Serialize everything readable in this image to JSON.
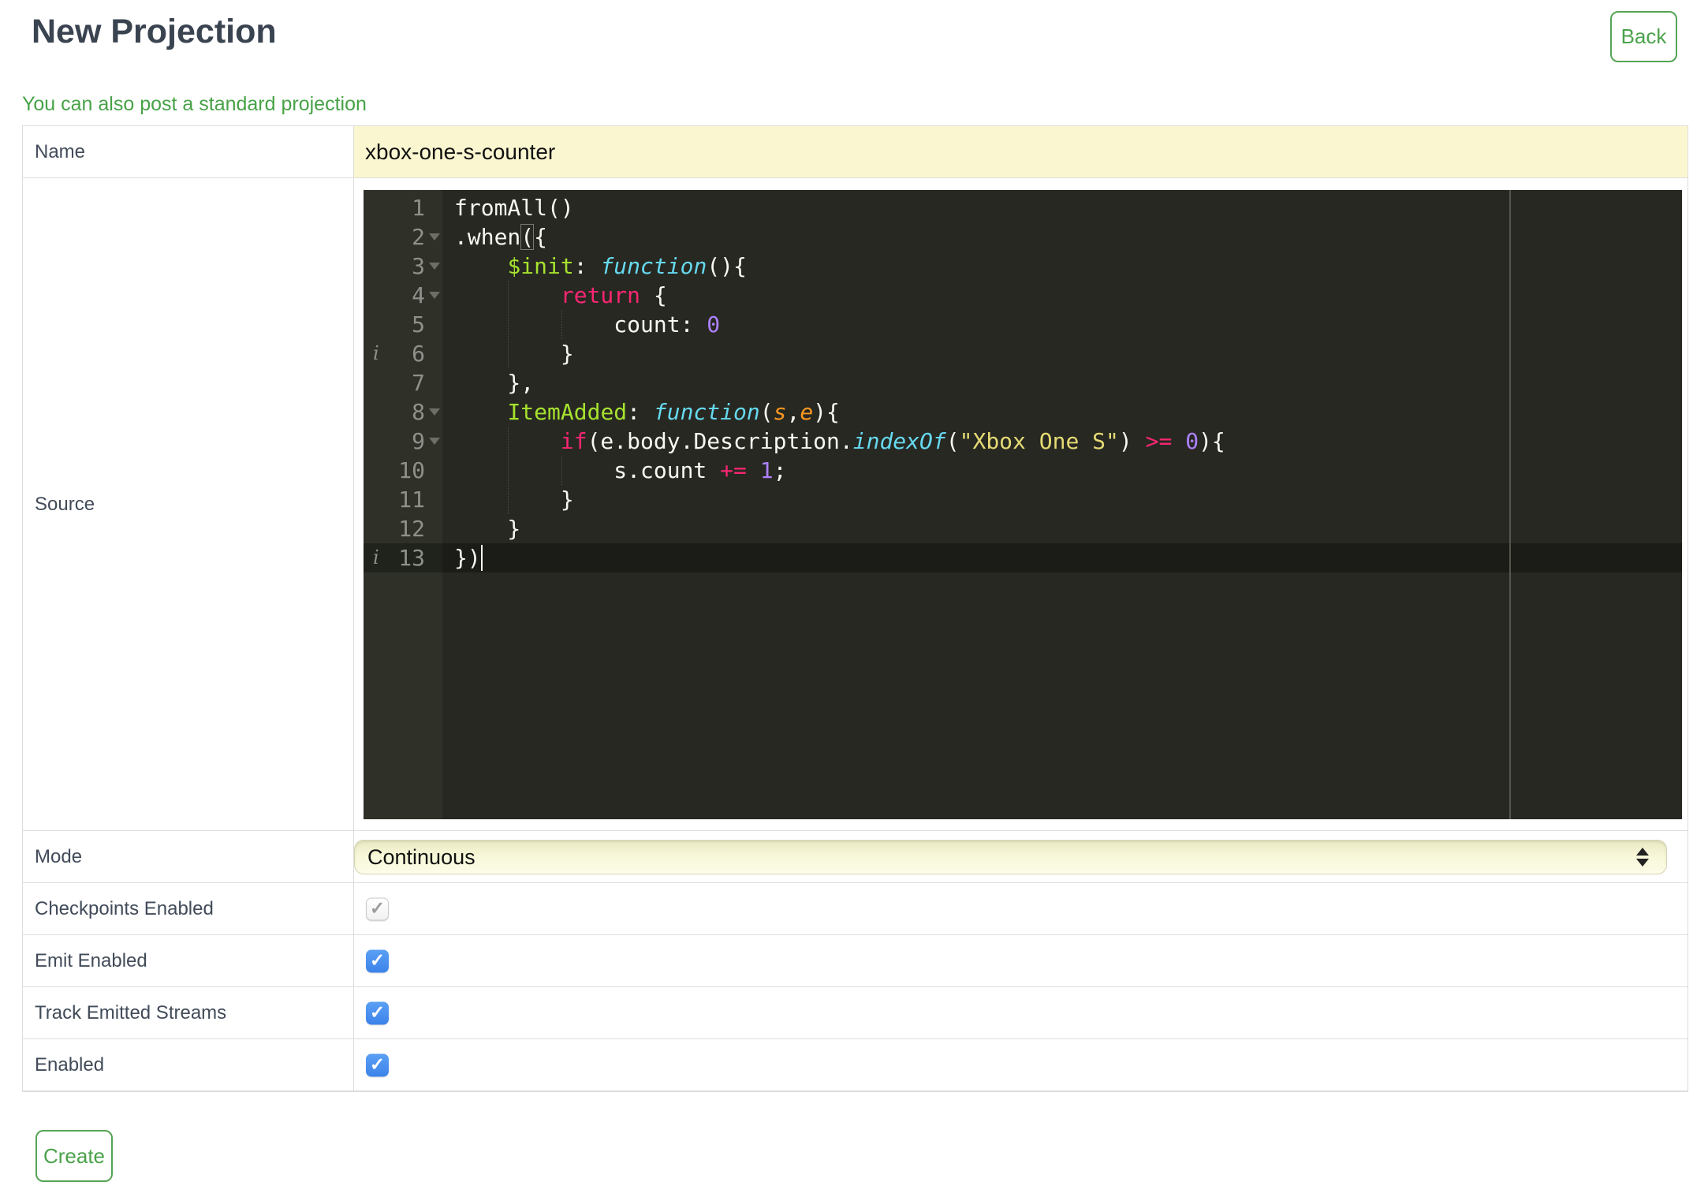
{
  "page": {
    "title": "New Projection"
  },
  "toolbar": {
    "back_label": "Back"
  },
  "links": {
    "standard_projection": "You can also post a standard projection"
  },
  "form": {
    "rows": [
      {
        "label": "Name",
        "type": "text",
        "value": "xbox-one-s-counter"
      },
      {
        "label": "Source",
        "type": "editor"
      },
      {
        "label": "Mode",
        "type": "select",
        "value": "Continuous"
      },
      {
        "label": "Checkpoints Enabled",
        "type": "checkbox",
        "checked": true,
        "disabled": true
      },
      {
        "label": "Emit Enabled",
        "type": "checkbox",
        "checked": true,
        "disabled": false
      },
      {
        "label": "Track Emitted Streams",
        "type": "checkbox",
        "checked": true,
        "disabled": false
      },
      {
        "label": "Enabled",
        "type": "checkbox",
        "checked": true,
        "disabled": false
      }
    ],
    "create_label": "Create"
  },
  "colors": {
    "accent_green": "#4ba24b",
    "input_yellow": "#faf7d0",
    "checkbox_blue": "#3c83ea",
    "editor_background": "#272822",
    "keyword": "#f92672",
    "entity": "#a6e22e",
    "function": "#66d9ef",
    "string": "#e6db74",
    "number": "#ae81ff",
    "param": "#fd971f"
  },
  "editor": {
    "language": "javascript",
    "lines": [
      {
        "number": 1,
        "tokens": [
          [
            "w",
            "fromAll()"
          ]
        ]
      },
      {
        "number": 2,
        "fold": true,
        "tokens": [
          [
            "w",
            ".when"
          ],
          [
            "m",
            "("
          ],
          [
            "w",
            "{"
          ]
        ]
      },
      {
        "number": 3,
        "fold": true,
        "tokens": [
          [
            "w",
            "    "
          ],
          [
            "e",
            "$init"
          ],
          [
            "w",
            ": "
          ],
          [
            "f",
            "function"
          ],
          [
            "w",
            "(){"
          ]
        ]
      },
      {
        "number": 4,
        "fold": true,
        "tokens": [
          [
            "w",
            "        "
          ],
          [
            "k",
            "return"
          ],
          [
            "w",
            " {"
          ]
        ]
      },
      {
        "number": 5,
        "tokens": [
          [
            "w",
            "            count: "
          ],
          [
            "n",
            "0"
          ]
        ]
      },
      {
        "number": 6,
        "info": true,
        "tokens": [
          [
            "w",
            "        }"
          ]
        ]
      },
      {
        "number": 7,
        "tokens": [
          [
            "w",
            "    },"
          ]
        ]
      },
      {
        "number": 8,
        "fold": true,
        "tokens": [
          [
            "w",
            "    "
          ],
          [
            "e",
            "ItemAdded"
          ],
          [
            "w",
            ": "
          ],
          [
            "f",
            "function"
          ],
          [
            "w",
            "("
          ],
          [
            "p",
            "s"
          ],
          [
            "w",
            ","
          ],
          [
            "p",
            "e"
          ],
          [
            "w",
            "){"
          ]
        ]
      },
      {
        "number": 9,
        "fold": true,
        "tokens": [
          [
            "w",
            "        "
          ],
          [
            "k",
            "if"
          ],
          [
            "w",
            "(e.body.Description."
          ],
          [
            "f",
            "indexOf"
          ],
          [
            "w",
            "("
          ],
          [
            "s",
            "\"Xbox One S\""
          ],
          [
            "w",
            ") "
          ],
          [
            "k",
            ">="
          ],
          [
            "w",
            " "
          ],
          [
            "n",
            "0"
          ],
          [
            "w",
            "){"
          ]
        ]
      },
      {
        "number": 10,
        "tokens": [
          [
            "w",
            "            s.count "
          ],
          [
            "k",
            "+="
          ],
          [
            "w",
            " "
          ],
          [
            "n",
            "1"
          ],
          [
            "w",
            ";"
          ]
        ]
      },
      {
        "number": 11,
        "tokens": [
          [
            "w",
            "        }"
          ]
        ]
      },
      {
        "number": 12,
        "tokens": [
          [
            "w",
            "    }"
          ]
        ]
      },
      {
        "number": 13,
        "info": true,
        "active": true,
        "cursor": true,
        "tokens": [
          [
            "w",
            "})"
          ]
        ]
      }
    ]
  }
}
